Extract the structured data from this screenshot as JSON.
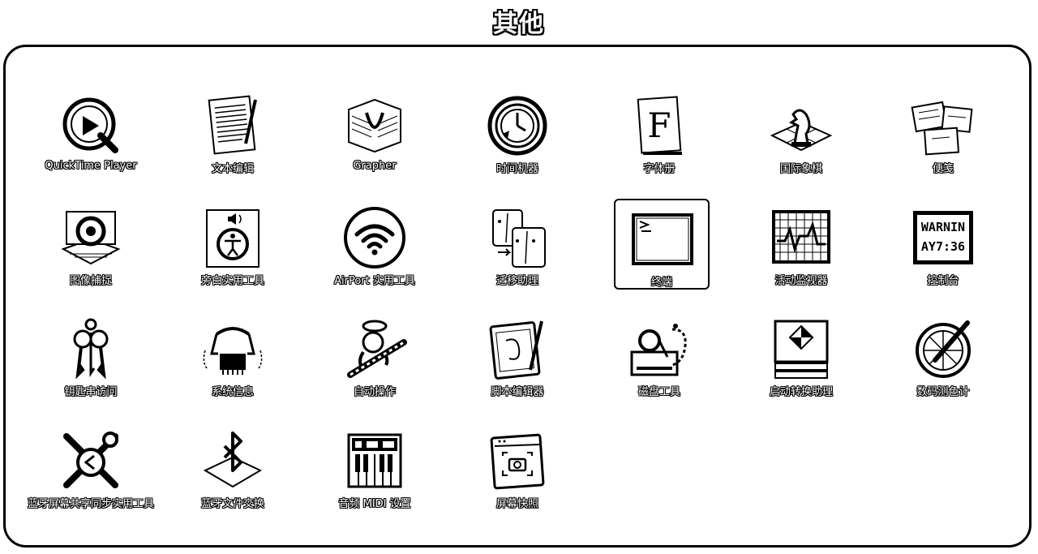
{
  "folder": {
    "title": "其他"
  },
  "apps": [
    {
      "label": "QuickTime Player",
      "icon": "quicktime-icon"
    },
    {
      "label": "文本编辑",
      "icon": "textedit-icon"
    },
    {
      "label": "Grapher",
      "icon": "grapher-icon"
    },
    {
      "label": "时间机器",
      "icon": "time-machine-icon"
    },
    {
      "label": "字体册",
      "icon": "font-book-icon"
    },
    {
      "label": "国际象棋",
      "icon": "chess-icon"
    },
    {
      "label": "便笺",
      "icon": "stickies-icon"
    },
    {
      "label": "图像捕捉",
      "icon": "image-capture-icon"
    },
    {
      "label": "旁白实用工具",
      "icon": "voiceover-utility-icon"
    },
    {
      "label": "AirPort 实用工具",
      "icon": "airport-utility-icon"
    },
    {
      "label": "迁移助理",
      "icon": "migration-assistant-icon"
    },
    {
      "label": "终端",
      "icon": "terminal-icon",
      "selected": true
    },
    {
      "label": "活动监视器",
      "icon": "activity-monitor-icon"
    },
    {
      "label": "控制台",
      "icon": "console-icon"
    },
    {
      "label": "钥匙串访问",
      "icon": "keychain-access-icon"
    },
    {
      "label": "系统信息",
      "icon": "system-information-icon"
    },
    {
      "label": "自动操作",
      "icon": "automator-icon"
    },
    {
      "label": "脚本编辑器",
      "icon": "script-editor-icon"
    },
    {
      "label": "磁盘工具",
      "icon": "disk-utility-icon"
    },
    {
      "label": "启动转换助理",
      "icon": "boot-camp-assistant-icon"
    },
    {
      "label": "数码测色计",
      "icon": "digital-color-meter-icon"
    },
    {
      "label": "蓝牙屏幕共享同步实用工具",
      "icon": "bluetooth-screen-sharing-icon"
    },
    {
      "label": "蓝牙文件交换",
      "icon": "bluetooth-file-exchange-icon"
    },
    {
      "label": "音频 MIDI 设置",
      "icon": "audio-midi-setup-icon"
    },
    {
      "label": "屏幕快照",
      "icon": "screenshot-icon"
    }
  ],
  "console_icon_text": [
    "WARNIN",
    "AY7:36"
  ]
}
